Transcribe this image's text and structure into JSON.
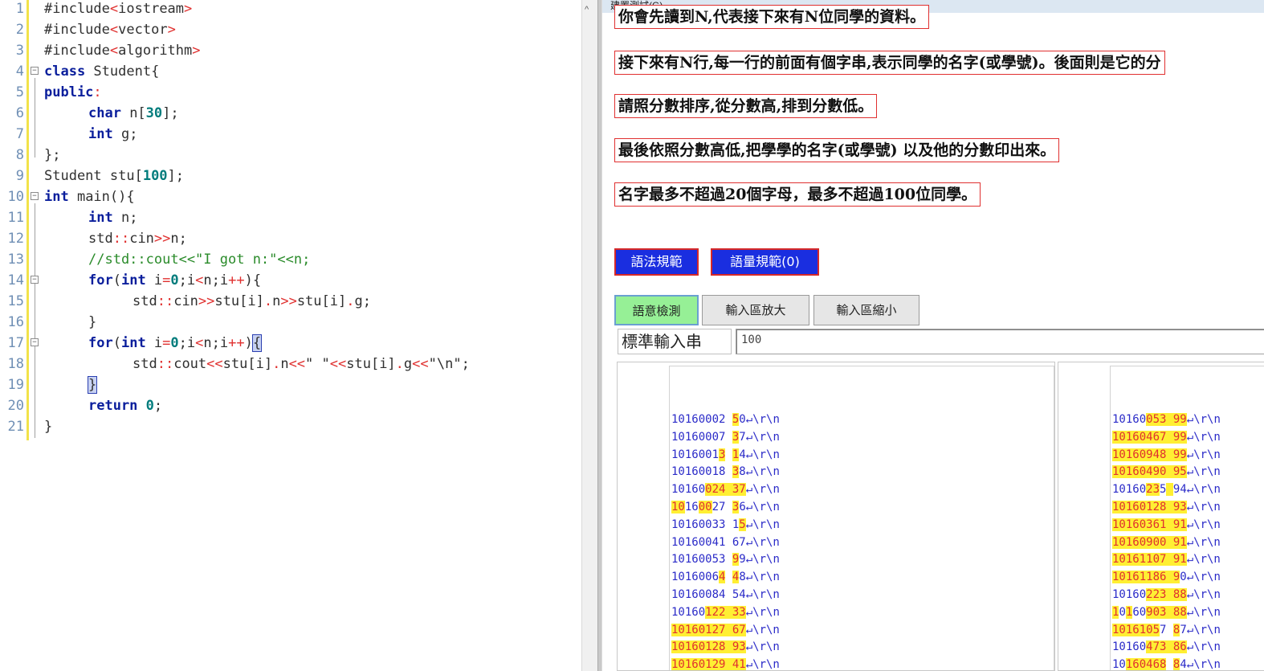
{
  "editor": {
    "lines": [
      {
        "n": "1",
        "indent": 0,
        "fold": false,
        "tokens": [
          {
            "t": "#include",
            "c": ""
          },
          {
            "t": "<",
            "c": "op"
          },
          {
            "t": "iostream",
            "c": ""
          },
          {
            "t": ">",
            "c": "op"
          }
        ]
      },
      {
        "n": "2",
        "indent": 0,
        "fold": false,
        "tokens": [
          {
            "t": "#include",
            "c": ""
          },
          {
            "t": "<",
            "c": "op"
          },
          {
            "t": "vector",
            "c": ""
          },
          {
            "t": ">",
            "c": "op"
          }
        ]
      },
      {
        "n": "3",
        "indent": 0,
        "fold": false,
        "tokens": [
          {
            "t": "#include",
            "c": ""
          },
          {
            "t": "<",
            "c": "op"
          },
          {
            "t": "algorithm",
            "c": ""
          },
          {
            "t": ">",
            "c": "op"
          }
        ]
      },
      {
        "n": "4",
        "indent": 0,
        "fold": true,
        "tokens": [
          {
            "t": "class",
            "c": "kw"
          },
          {
            "t": " Student{",
            "c": ""
          }
        ]
      },
      {
        "n": "5",
        "indent": 0,
        "fold": false,
        "tokens": [
          {
            "t": "public:",
            "c": "kw2"
          }
        ]
      },
      {
        "n": "6",
        "indent": 1,
        "fold": false,
        "tokens": [
          {
            "t": "char",
            "c": "kw"
          },
          {
            "t": " n[",
            "c": ""
          },
          {
            "t": "30",
            "c": "num"
          },
          {
            "t": "];",
            "c": ""
          }
        ]
      },
      {
        "n": "7",
        "indent": 1,
        "fold": false,
        "tokens": [
          {
            "t": "int",
            "c": "kw"
          },
          {
            "t": " g;",
            "c": ""
          }
        ]
      },
      {
        "n": "8",
        "indent": 0,
        "fold": false,
        "tokens": [
          {
            "t": "};",
            "c": ""
          }
        ]
      },
      {
        "n": "9",
        "indent": 0,
        "fold": false,
        "tokens": [
          {
            "t": "Student stu[",
            "c": ""
          },
          {
            "t": "100",
            "c": "num"
          },
          {
            "t": "];",
            "c": ""
          }
        ]
      },
      {
        "n": "10",
        "indent": 0,
        "fold": true,
        "tokens": [
          {
            "t": "int",
            "c": "kw"
          },
          {
            "t": " main(){",
            "c": ""
          }
        ]
      },
      {
        "n": "11",
        "indent": 1,
        "fold": false,
        "tokens": [
          {
            "t": "int",
            "c": "kw"
          },
          {
            "t": " n;",
            "c": ""
          }
        ]
      },
      {
        "n": "12",
        "indent": 1,
        "fold": false,
        "tokens": [
          {
            "t": "std",
            "c": ""
          },
          {
            "t": "::",
            "c": "op"
          },
          {
            "t": "cin",
            "c": ""
          },
          {
            "t": ">>",
            "c": "op"
          },
          {
            "t": "n;",
            "c": ""
          }
        ]
      },
      {
        "n": "13",
        "indent": 1,
        "fold": false,
        "tokens": [
          {
            "t": "//std::cout<<\"I got n:\"<<n;",
            "c": "cm"
          }
        ]
      },
      {
        "n": "14",
        "indent": 1,
        "fold": true,
        "tokens": [
          {
            "t": "for",
            "c": "kw"
          },
          {
            "t": "(",
            "c": ""
          },
          {
            "t": "int",
            "c": "kw"
          },
          {
            "t": " i",
            "c": ""
          },
          {
            "t": "=",
            "c": "op"
          },
          {
            "t": "0",
            "c": "num"
          },
          {
            "t": ";i",
            "c": ""
          },
          {
            "t": "<",
            "c": "op"
          },
          {
            "t": "n;i",
            "c": ""
          },
          {
            "t": "++",
            "c": "op"
          },
          {
            "t": "){",
            "c": ""
          }
        ]
      },
      {
        "n": "15",
        "indent": 2,
        "fold": false,
        "tokens": [
          {
            "t": "std",
            "c": ""
          },
          {
            "t": "::",
            "c": "op"
          },
          {
            "t": "cin",
            "c": ""
          },
          {
            "t": ">>",
            "c": "op"
          },
          {
            "t": "stu[i]",
            "c": ""
          },
          {
            "t": ".",
            "c": "op"
          },
          {
            "t": "n",
            "c": ""
          },
          {
            "t": ">>",
            "c": "op"
          },
          {
            "t": "stu[i]",
            "c": ""
          },
          {
            "t": ".",
            "c": "op"
          },
          {
            "t": "g;",
            "c": ""
          }
        ]
      },
      {
        "n": "16",
        "indent": 1,
        "fold": false,
        "tokens": [
          {
            "t": "}",
            "c": ""
          }
        ]
      },
      {
        "n": "17",
        "indent": 1,
        "fold": true,
        "tokens": [
          {
            "t": "for",
            "c": "kw"
          },
          {
            "t": "(",
            "c": ""
          },
          {
            "t": "int",
            "c": "kw"
          },
          {
            "t": " i",
            "c": ""
          },
          {
            "t": "=",
            "c": "op"
          },
          {
            "t": "0",
            "c": "num"
          },
          {
            "t": ";i",
            "c": ""
          },
          {
            "t": "<",
            "c": "op"
          },
          {
            "t": "n;i",
            "c": ""
          },
          {
            "t": "++",
            "c": "op"
          },
          {
            "t": ")",
            "c": ""
          },
          {
            "t": "{",
            "c": "brace"
          }
        ]
      },
      {
        "n": "18",
        "indent": 2,
        "fold": false,
        "tokens": [
          {
            "t": "std",
            "c": ""
          },
          {
            "t": "::",
            "c": "op"
          },
          {
            "t": "cout",
            "c": ""
          },
          {
            "t": "<<",
            "c": "op"
          },
          {
            "t": "stu[i]",
            "c": ""
          },
          {
            "t": ".",
            "c": "op"
          },
          {
            "t": "n",
            "c": ""
          },
          {
            "t": "<<",
            "c": "op"
          },
          {
            "t": "\" \"",
            "c": ""
          },
          {
            "t": "<<",
            "c": "op"
          },
          {
            "t": "stu[i]",
            "c": ""
          },
          {
            "t": ".",
            "c": "op"
          },
          {
            "t": "g",
            "c": ""
          },
          {
            "t": "<<",
            "c": "op"
          },
          {
            "t": "\"\\n\";",
            "c": ""
          }
        ]
      },
      {
        "n": "19",
        "indent": 1,
        "fold": false,
        "tokens": [
          {
            "t": "}",
            "c": "brace"
          }
        ]
      },
      {
        "n": "20",
        "indent": 1,
        "fold": false,
        "tokens": [
          {
            "t": "return",
            "c": "kw"
          },
          {
            "t": " ",
            "c": ""
          },
          {
            "t": "0",
            "c": "num"
          },
          {
            "t": ";",
            "c": ""
          }
        ]
      },
      {
        "n": "21",
        "indent": 0,
        "fold": false,
        "tokens": [
          {
            "t": "}",
            "c": ""
          }
        ]
      }
    ]
  },
  "panel": {
    "title": "建置測試(G)",
    "statements": [
      "你會先讀到N,代表接下來有N位同學的資料。",
      "接下來有N行,每一行的前面有個字串,表示同學的名字(或學號)。後面則是它的分",
      "請照分數排序,從分數高,排到分數低。",
      "最後依照分數高低,把學學的名字(或學號) 以及他的分數印出來。",
      "名字最多不超過20個字母，最多不超過100位同學。"
    ],
    "syntax_button": "語法規範",
    "vocab_button": "語量規範(0)",
    "semantic_button": "語意檢測",
    "enlarge_button": "輸入區放大",
    "shrink_button": "輸入區縮小",
    "stdin_label": "標準輸入串",
    "stdin_value": "100",
    "line_end": "↵\\r\\n",
    "input_rows": [
      {
        "a": "10160002 ",
        "b": "50",
        "mark": [
          [
            9,
            10
          ]
        ]
      },
      {
        "a": "10160007 ",
        "b": "37",
        "mark": [
          [
            9,
            10
          ]
        ]
      },
      {
        "a": "10160013 ",
        "b": "14",
        "mark": [
          [
            7,
            8
          ],
          [
            9,
            10
          ]
        ]
      },
      {
        "a": "10160018 ",
        "b": "38",
        "mark": [
          [
            9,
            10
          ]
        ]
      },
      {
        "a": "10160024 ",
        "b": "37",
        "mark": [
          [
            5,
            11
          ]
        ]
      },
      {
        "a": "10160027 ",
        "b": "36",
        "mark": [
          [
            0,
            2
          ],
          [
            4,
            6
          ],
          [
            9,
            10
          ]
        ]
      },
      {
        "a": "10160033 ",
        "b": "15",
        "mark": [
          [
            10,
            11
          ]
        ]
      },
      {
        "a": "10160041 ",
        "b": "67",
        "mark": []
      },
      {
        "a": "10160053 ",
        "b": "99",
        "mark": [
          [
            9,
            10
          ]
        ]
      },
      {
        "a": "10160064 ",
        "b": "48",
        "mark": [
          [
            7,
            8
          ],
          [
            9,
            10
          ]
        ]
      },
      {
        "a": "10160084 ",
        "b": "54",
        "mark": []
      },
      {
        "a": "10160122 ",
        "b": "33",
        "mark": [
          [
            5,
            11
          ]
        ]
      },
      {
        "a": "10160127 ",
        "b": "67",
        "mark": [
          [
            0,
            11
          ]
        ]
      },
      {
        "a": "10160128 ",
        "b": "93",
        "mark": [
          [
            0,
            11
          ]
        ]
      },
      {
        "a": "10160129 ",
        "b": "41",
        "mark": [
          [
            0,
            11
          ]
        ]
      }
    ],
    "output_rows": [
      {
        "a": "10160053 ",
        "b": "99",
        "mark": [
          [
            5,
            11
          ]
        ]
      },
      {
        "a": "10160467 ",
        "b": "99",
        "mark": [
          [
            0,
            11
          ]
        ]
      },
      {
        "a": "10160948 ",
        "b": "99",
        "mark": [
          [
            0,
            11
          ]
        ]
      },
      {
        "a": "10160490 ",
        "b": "95",
        "mark": [
          [
            0,
            11
          ]
        ]
      },
      {
        "a": "10160235 ",
        "b": "94",
        "mark": [
          [
            5,
            7
          ],
          [
            8,
            9
          ]
        ]
      },
      {
        "a": "10160128 ",
        "b": "93",
        "mark": [
          [
            0,
            11
          ]
        ]
      },
      {
        "a": "10160361 ",
        "b": "91",
        "mark": [
          [
            0,
            11
          ]
        ]
      },
      {
        "a": "10160900 ",
        "b": "91",
        "mark": [
          [
            0,
            11
          ]
        ]
      },
      {
        "a": "10161107 ",
        "b": "91",
        "mark": [
          [
            0,
            11
          ]
        ]
      },
      {
        "a": "10161186 ",
        "b": "90",
        "mark": [
          [
            0,
            10
          ]
        ]
      },
      {
        "a": "10160223 ",
        "b": "88",
        "mark": [
          [
            5,
            11
          ]
        ]
      },
      {
        "a": "10160903 ",
        "b": "88",
        "mark": [
          [
            0,
            1
          ],
          [
            2,
            3
          ],
          [
            5,
            11
          ]
        ]
      },
      {
        "a": "10161057 ",
        "b": "87",
        "mark": [
          [
            0,
            7
          ],
          [
            9,
            10
          ]
        ]
      },
      {
        "a": "10160473 ",
        "b": "86",
        "mark": [
          [
            5,
            11
          ]
        ]
      },
      {
        "a": "10160468 ",
        "b": "84",
        "mark": [
          [
            2,
            8
          ],
          [
            9,
            10
          ]
        ]
      }
    ]
  }
}
